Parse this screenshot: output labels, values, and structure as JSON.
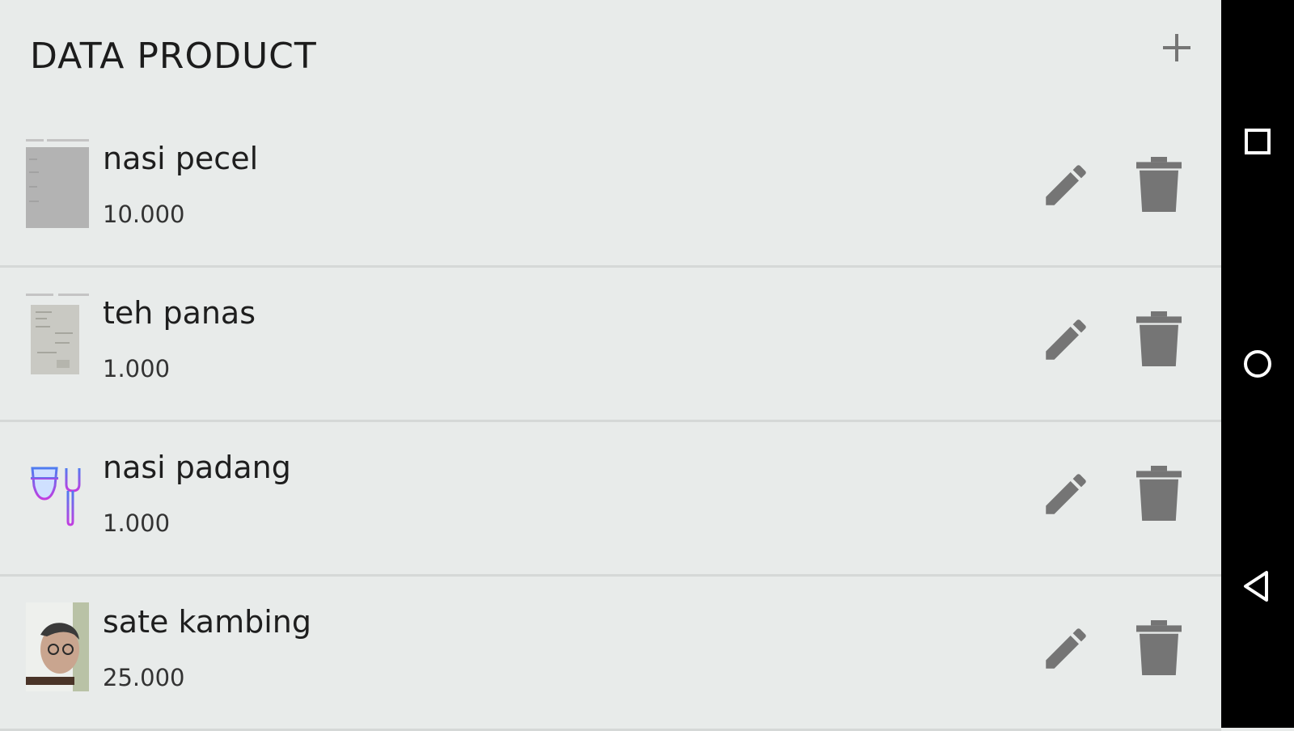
{
  "header": {
    "title": "DATA PRODUCT",
    "add_icon": "plus-icon"
  },
  "products": [
    {
      "name": "nasi pecel",
      "price": "10.000",
      "thumbnail": "document-photo"
    },
    {
      "name": "teh panas",
      "price": "1.000",
      "thumbnail": "document-photo"
    },
    {
      "name": "nasi padang",
      "price": "1.000",
      "thumbnail": "glass-fork-icon"
    },
    {
      "name": "sate kambing",
      "price": "25.000",
      "thumbnail": "person-photo"
    }
  ],
  "row_actions": {
    "edit_icon": "pencil-icon",
    "delete_icon": "trash-icon"
  },
  "navbar": {
    "items": [
      "recents-square-icon",
      "home-circle-icon",
      "back-triangle-icon"
    ]
  },
  "colors": {
    "background": "#e8ebea",
    "icon_gray": "#757575",
    "navbar": "#000000",
    "divider": "#d5d8d7"
  }
}
